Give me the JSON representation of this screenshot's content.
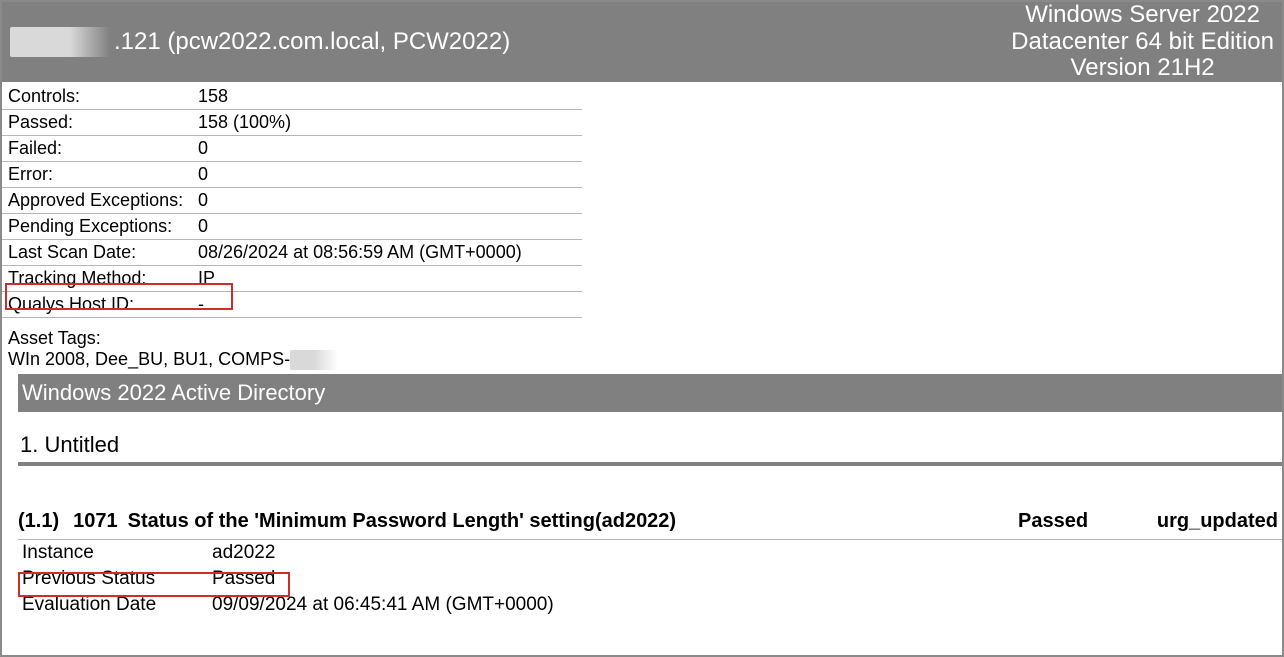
{
  "header": {
    "host_suffix": ".121 (pcw2022.com.local, PCW2022)",
    "os_line1": "Windows Server 2022",
    "os_line2": "Datacenter 64 bit Edition",
    "os_line3": "Version 21H2"
  },
  "summary": {
    "controls_label": "Controls:",
    "controls_value": "158",
    "passed_label": "Passed:",
    "passed_value": "158 (100%)",
    "failed_label": "Failed:",
    "failed_value": "0",
    "error_label": "Error:",
    "error_value": "0",
    "approved_ex_label": "Approved Exceptions:",
    "approved_ex_value": "0",
    "pending_ex_label": "Pending Exceptions:",
    "pending_ex_value": "0",
    "last_scan_label": "Last Scan Date:",
    "last_scan_value": "08/26/2024 at 08:56:59 AM (GMT+0000)",
    "tracking_label": "Tracking Method:",
    "tracking_value": "IP",
    "host_id_label": "Qualys Host ID:",
    "host_id_value": "-"
  },
  "tags": {
    "label": "Asset Tags:",
    "value_prefix": "WIn 2008, Dee_BU, BU1, COMPS-"
  },
  "section": {
    "title": "Windows 2022 Active Directory",
    "subsection": "1. Untitled"
  },
  "control": {
    "num": "(1.1)",
    "id": "1071",
    "title": "Status of the 'Minimum Password Length' setting(ad2022)",
    "status": "Passed",
    "urg": "urg_updated"
  },
  "detail": {
    "instance_label": "Instance",
    "instance_value": "ad2022",
    "prev_label": "Previous Status",
    "prev_value": "Passed",
    "eval_label": "Evaluation Date",
    "eval_value": "09/09/2024 at 06:45:41 AM (GMT+0000)"
  }
}
